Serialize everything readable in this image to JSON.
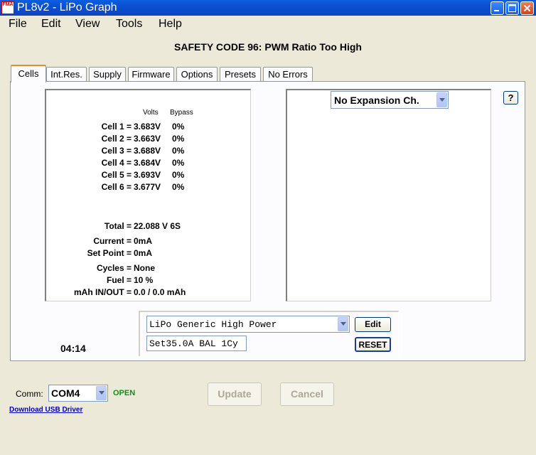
{
  "window": {
    "title": "PL8v2 - LiPo Graph",
    "icon_text": "FMA"
  },
  "menu": [
    {
      "label": "File"
    },
    {
      "label": "Edit"
    },
    {
      "label": "View"
    },
    {
      "label": "Tools"
    },
    {
      "label": "Help"
    }
  ],
  "safety_message": "SAFETY CODE 96:  PWM Ratio Too High",
  "tabs": [
    {
      "label": "Cells"
    },
    {
      "label": "Int.Res."
    },
    {
      "label": "Supply"
    },
    {
      "label": "Firmware"
    },
    {
      "label": "Options"
    },
    {
      "label": "Presets"
    },
    {
      "label": "No Errors"
    }
  ],
  "cells": {
    "headers": {
      "volts": "Volts",
      "bypass": "Bypass"
    },
    "rows": [
      {
        "label": "Cell 1 =",
        "value": "3.683V",
        "bypass": "0%"
      },
      {
        "label": "Cell 2 =",
        "value": "3.663V",
        "bypass": "0%"
      },
      {
        "label": "Cell 3 =",
        "value": "3.688V",
        "bypass": "0%"
      },
      {
        "label": "Cell 4 =",
        "value": "3.684V",
        "bypass": "0%"
      },
      {
        "label": "Cell 5 =",
        "value": "3.693V",
        "bypass": "0%"
      },
      {
        "label": "Cell 6 =",
        "value": "3.677V",
        "bypass": "0%"
      }
    ],
    "stats": {
      "total": {
        "label": "Total =",
        "value": "22.088 V  6S"
      },
      "current": {
        "label": "Current =",
        "value": "0mA"
      },
      "set_point": {
        "label": "Set Point =",
        "value": "0mA"
      },
      "cycles": {
        "label": "Cycles =",
        "value": "None"
      },
      "fuel": {
        "label": "Fuel =",
        "value": "10 %"
      },
      "mah": {
        "label": "mAh IN/OUT =",
        "value": "0.0 / 0.0 mAh"
      }
    }
  },
  "expansion": {
    "selected": "No Expansion Ch.",
    "help_label": "?"
  },
  "timer": "04:14",
  "preset": {
    "selected": "LiPo Generic High Power",
    "edit_label": "Edit",
    "summary": "Set35.0A BAL 1Cy",
    "reset_label": "RESET"
  },
  "comm": {
    "label": "Comm:",
    "port": "COM4",
    "status": "OPEN",
    "status_color": "#1a8a1a",
    "update_label": "Update",
    "cancel_label": "Cancel",
    "driver_link": "Download USB Driver"
  }
}
